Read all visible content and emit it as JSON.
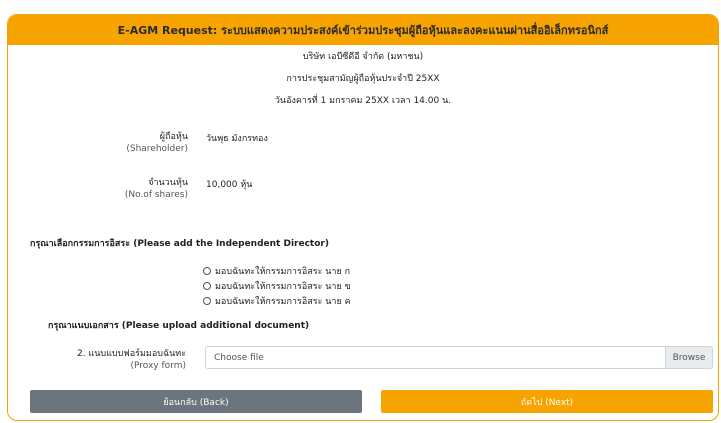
{
  "header": {
    "title": "E-AGM Request: ระบบแสดงความประสงค์เข้าร่วมประชุมผู้ถือหุ้นและลงคะแนนผ่านสื่ออิเล็กทรอนิกส์"
  },
  "company": {
    "name": "บริษัท เอบีซีดีอี จำกัด (มหาชน)",
    "meeting": "การประชุมสามัญผู้ถือหุ้นประจำปี 25XX",
    "date": "วันอังคารที่ 1 มกราคม 25XX เวลา 14.00 น."
  },
  "shareholder": {
    "label_th": "ผู้ถือหุ้น",
    "label_en": "(Shareholder)",
    "value": "วันพุธ มังกรทอง"
  },
  "shares": {
    "label_th": "จำนวนหุ้น",
    "label_en": "(No.of shares)",
    "value": "10,000 หุ้น"
  },
  "director_section": {
    "title": "กรุณาเลือกกรรมการอิสระ (Please add the Independent Director)",
    "options": [
      "มอบฉันทะให้กรรมการอิสระ นาย ก",
      "มอบฉันทะให้กรรมการอิสระ นาย ข",
      "มอบฉันทะให้กรรมการอิสระ นาย ค"
    ]
  },
  "upload_section": {
    "title": "กรุณาแนบเอกสาร (Please upload additional document)",
    "label_th": "2. แนบแบบฟอร์มมอบฉันทะ",
    "label_en": "(Proxy form)",
    "placeholder": "Choose file",
    "browse_label": "Browse"
  },
  "buttons": {
    "back": "ย้อนกลับ (Back)",
    "next": "ถัดไป (Next)"
  },
  "colors": {
    "accent": "#f7a300",
    "back_button": "#6c757d"
  }
}
